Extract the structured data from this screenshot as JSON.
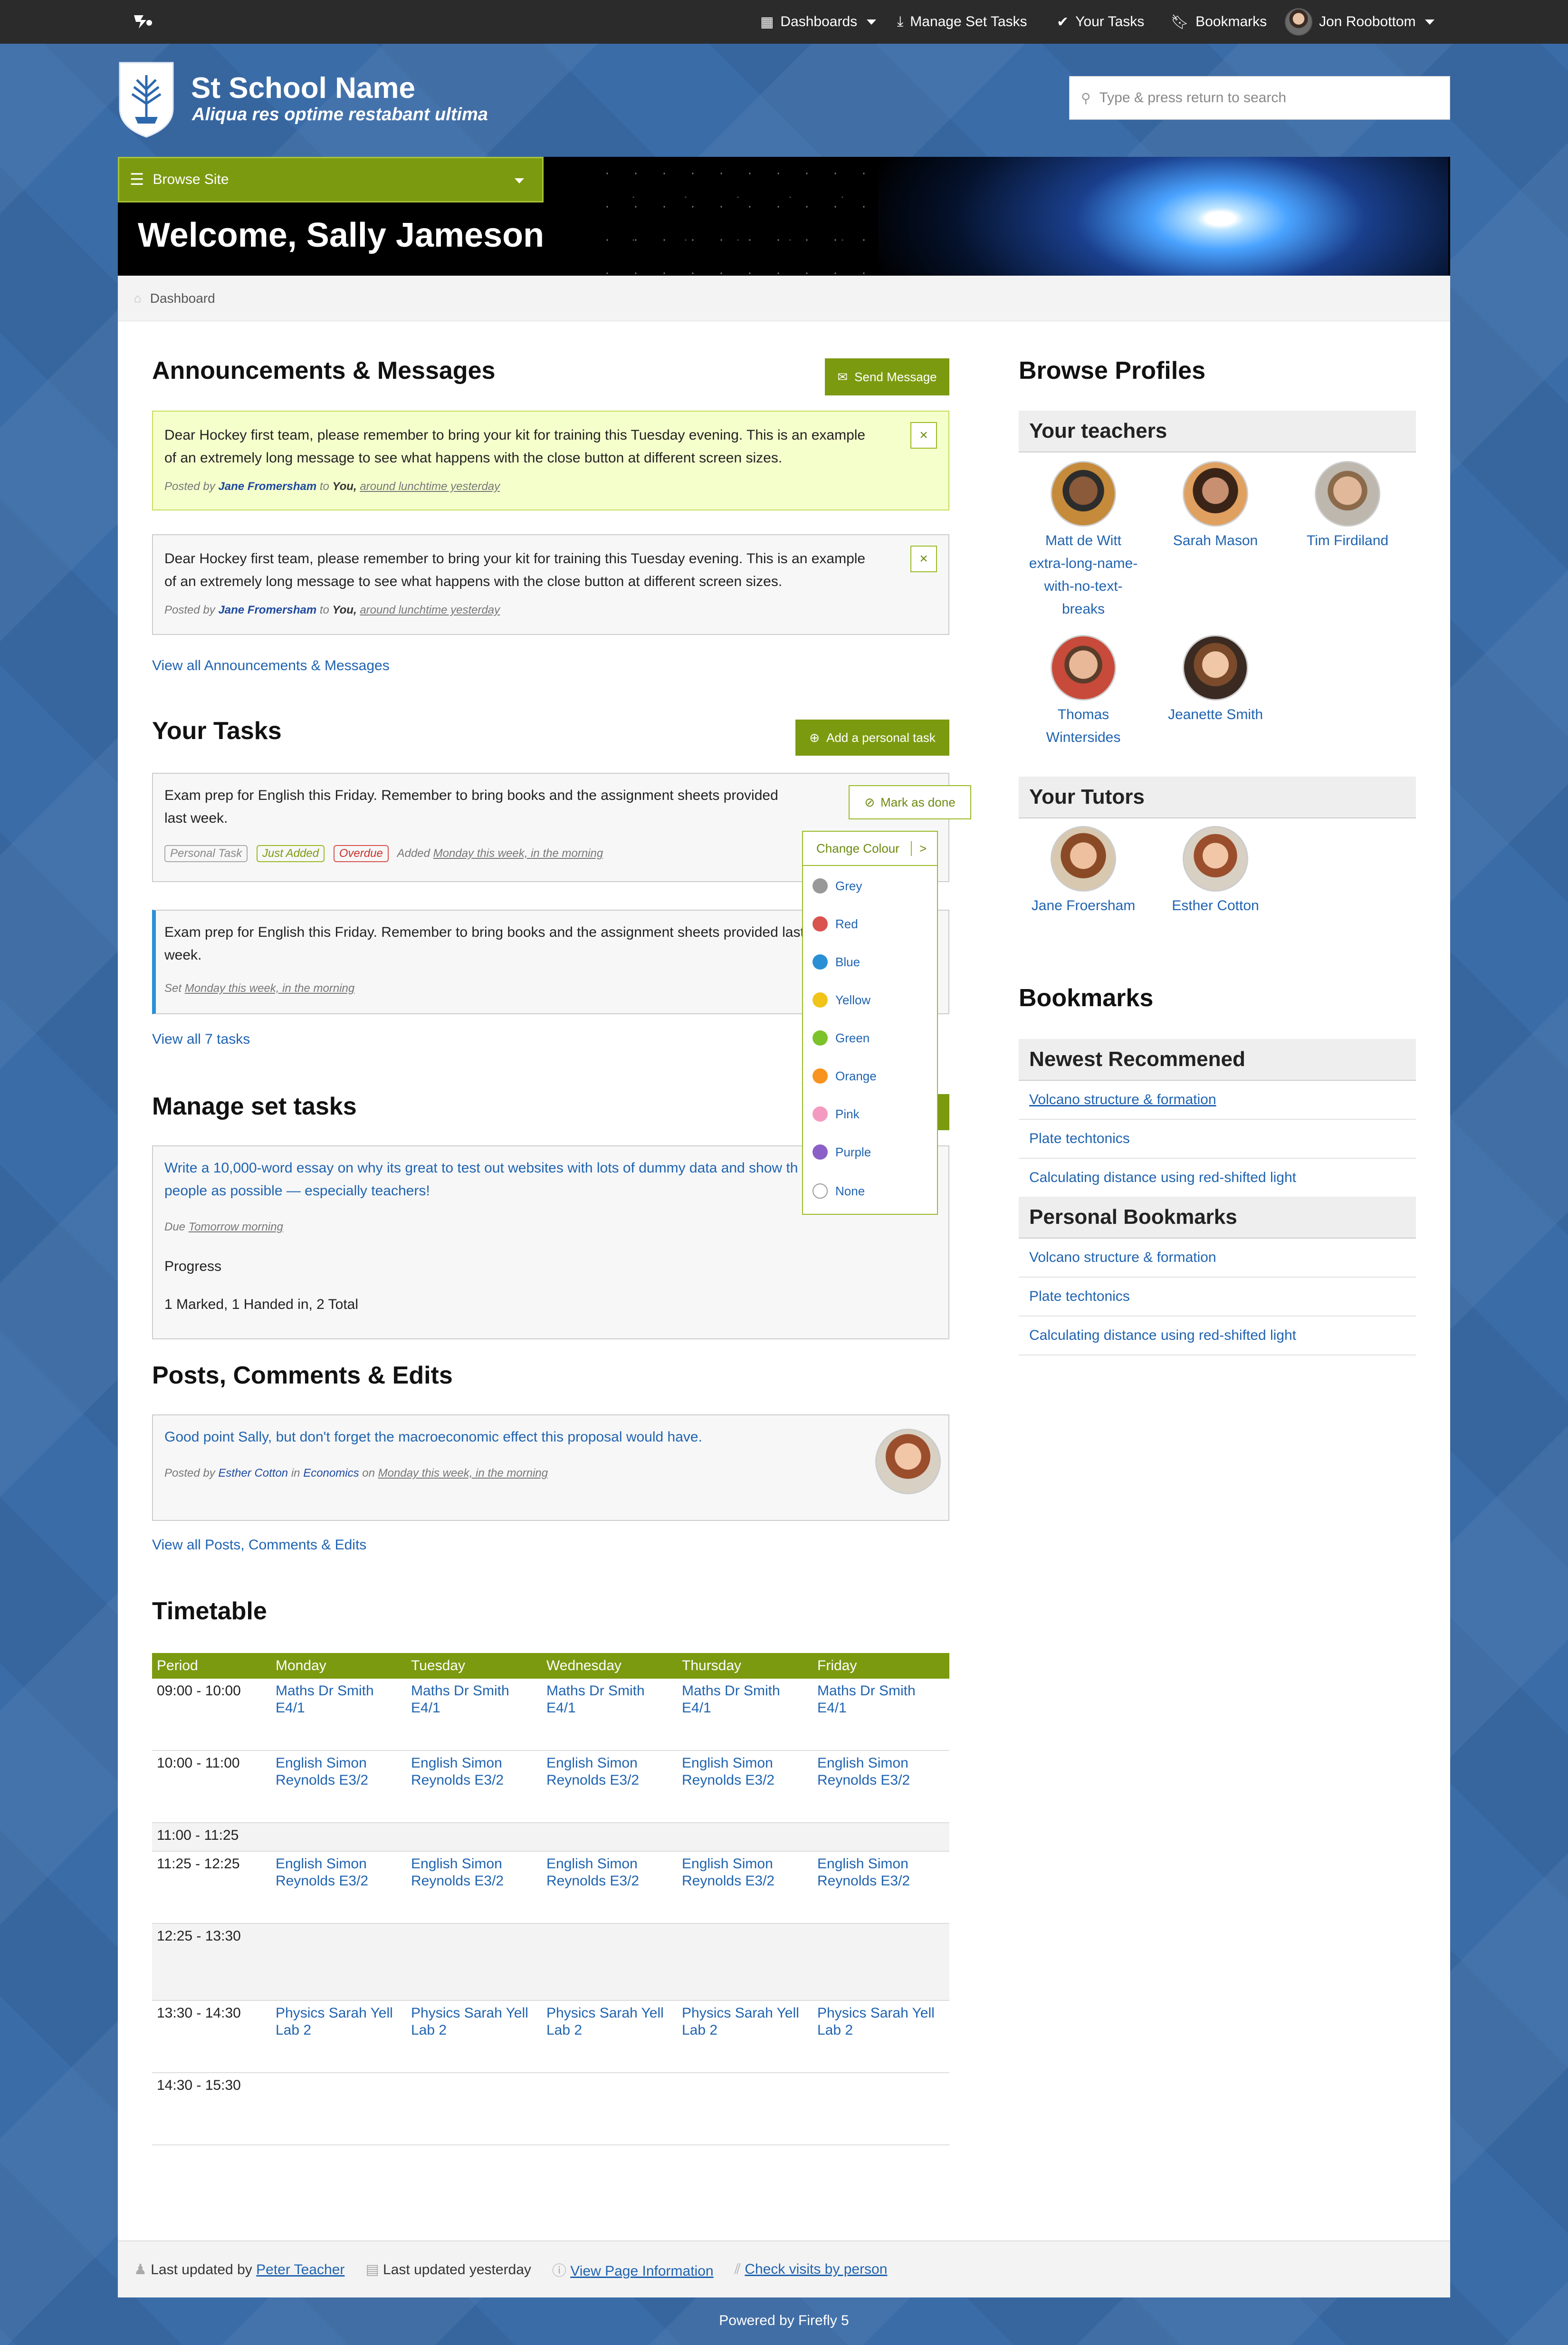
{
  "topbar": {
    "items": [
      {
        "icon": "grid-icon",
        "label": "Dashboards"
      },
      {
        "icon": "download-icon",
        "label": "Manage Set Tasks"
      },
      {
        "icon": "check-icon",
        "label": "Your Tasks"
      },
      {
        "icon": "bookmark-icon",
        "label": "Bookmarks"
      },
      {
        "icon": "avatar",
        "label": "Jon Roobottom"
      }
    ]
  },
  "header": {
    "school_name": "St School Name",
    "motto": "Aliqua res optime restabant ultima",
    "search_placeholder": "Type & press return to search"
  },
  "banner": {
    "browse_label": "Browse Site",
    "welcome": "Welcome, Sally Jameson"
  },
  "breadcrumb": {
    "label": "Dashboard"
  },
  "announcements": {
    "title": "Announcements & Messages",
    "send_label": "Send Message",
    "messages": [
      {
        "text": "Dear Hockey first team, please remember to bring your kit for training this Tuesday evening. This is an example of an extremely long message to see what happens with the close button at different screen sizes.",
        "posted_by": "Posted by",
        "author": "Jane Fromersham",
        "to": "to",
        "recipient": "You,",
        "when": "around lunchtime yesterday"
      },
      {
        "text": "Dear Hockey first team, please remember to bring your kit for training this Tuesday evening. This is an example of an extremely long message to see what happens with the close button at different screen sizes.",
        "posted_by": "Posted by",
        "author": "Jane Fromersham",
        "to": "to",
        "recipient": "You,",
        "when": "around lunchtime yesterday"
      }
    ],
    "view_all": "View all Announcements & Messages"
  },
  "tasks": {
    "title": "Your Tasks",
    "add_label": "Add a personal task",
    "items": [
      {
        "text": "Exam prep for English this Friday. Remember to bring books and the assignment sheets provided last week.",
        "tags": [
          "Personal Task",
          "Just Added",
          "Overdue"
        ],
        "added": "Added",
        "added_when": "Monday this week, in the morning",
        "mark_done": "Mark as done"
      },
      {
        "text": "Exam prep for English this Friday. Remember to bring books and the assignment sheets provided last week.",
        "set_label": "Set",
        "set_when": "Monday this week, in the morning"
      }
    ],
    "view_all": "View all 7 tasks",
    "colour_menu": {
      "title": "Change Colour",
      "arrow": ">",
      "options": [
        {
          "label": "Grey",
          "color": "#999999"
        },
        {
          "label": "Red",
          "color": "#d9534f"
        },
        {
          "label": "Blue",
          "color": "#2b8fd6"
        },
        {
          "label": "Yellow",
          "color": "#f0c419"
        },
        {
          "label": "Green",
          "color": "#7cc22a"
        },
        {
          "label": "Orange",
          "color": "#f7931e"
        },
        {
          "label": "Pink",
          "color": "#f49ac1"
        },
        {
          "label": "Purple",
          "color": "#8b5fc7"
        },
        {
          "label": "None",
          "color": "#ffffff"
        }
      ]
    }
  },
  "set_tasks": {
    "title": "Manage set tasks",
    "task_text": "Write a 10,000-word essay on why its great to test out websites with lots of dummy data and show th",
    "task_text_line2": "people as possible — especially teachers!",
    "due_label": "Due",
    "due_when": "Tomorrow morning",
    "progress_label": "Progress",
    "progress_summary": "1 Marked, 1 Handed in, 2 Total"
  },
  "posts": {
    "title": "Posts, Comments & Edits",
    "text": "Good point Sally, but don't forget the macroeconomic effect this proposal would have.",
    "posted_by": "Posted by",
    "author": "Esther Cotton",
    "in": "in",
    "subject": "Economics",
    "on": "on",
    "when": "Monday this week, in the morning",
    "view_all": "View all Posts, Comments & Edits"
  },
  "timetable": {
    "title": "Timetable",
    "headers": [
      "Period",
      "Monday",
      "Tuesday",
      "Wednesday",
      "Thursday",
      "Friday"
    ],
    "rows": [
      {
        "period": "09:00 - 10:00",
        "cells": [
          "Maths Dr Smith E4/1",
          "Maths Dr Smith E4/1",
          "Maths Dr Smith E4/1",
          "Maths Dr Smith E4/1",
          "Maths Dr Smith E4/1"
        ]
      },
      {
        "period": "10:00 - 11:00",
        "cells": [
          "English Simon Reynolds E3/2",
          "English Simon Reynolds E3/2",
          "English Simon Reynolds E3/2",
          "English Simon Reynolds E3/2",
          "English Simon Reynolds E3/2"
        ]
      },
      {
        "period": "11:00 - 11:25",
        "cells": [
          "",
          "",
          "",
          "",
          ""
        ],
        "shade": true
      },
      {
        "period": "11:25 - 12:25",
        "cells": [
          "English Simon Reynolds E3/2",
          "English Simon Reynolds E3/2",
          "English Simon Reynolds E3/2",
          "English Simon Reynolds E3/2",
          "English Simon Reynolds E3/2"
        ]
      },
      {
        "period": "12:25 - 13:30",
        "cells": [
          "",
          "",
          "",
          "",
          ""
        ],
        "shade": true
      },
      {
        "period": "13:30 - 14:30",
        "cells": [
          "Physics Sarah Yell Lab 2",
          "Physics Sarah Yell Lab 2",
          "Physics Sarah Yell Lab 2",
          "Physics Sarah Yell Lab 2",
          "Physics Sarah Yell Lab 2"
        ]
      },
      {
        "period": "14:30 - 15:30",
        "cells": [
          "",
          "",
          "",
          "",
          ""
        ]
      }
    ]
  },
  "profiles": {
    "title": "Browse Profiles",
    "teachers_title": "Your teachers",
    "teachers": [
      {
        "name": "Matt de Witt extra-long-name-with-no-text-breaks"
      },
      {
        "name": "Sarah Mason"
      },
      {
        "name": "Tim Firdiland"
      },
      {
        "name": "Thomas Wintersides"
      },
      {
        "name": "Jeanette Smith"
      }
    ],
    "tutors_title": "Your Tutors",
    "tutors": [
      {
        "name": "Jane Froersham"
      },
      {
        "name": "Esther Cotton"
      }
    ]
  },
  "bookmarks": {
    "title": "Bookmarks",
    "newest_title": "Newest Recommened",
    "newest": [
      "Volcano structure & formation",
      "Plate techtonics",
      "Calculating distance using red-shifted light"
    ],
    "personal_title": "Personal Bookmarks",
    "personal": [
      "Volcano structure & formation",
      "Plate techtonics",
      "Calculating distance using red-shifted light"
    ]
  },
  "footer": {
    "updated_by_label": "Last updated by",
    "updated_by": "Peter Teacher",
    "updated_when": "Last updated yesterday",
    "page_info": "View Page Information",
    "visits": "Check visits by person",
    "powered": "Powered by Firefly 5"
  }
}
